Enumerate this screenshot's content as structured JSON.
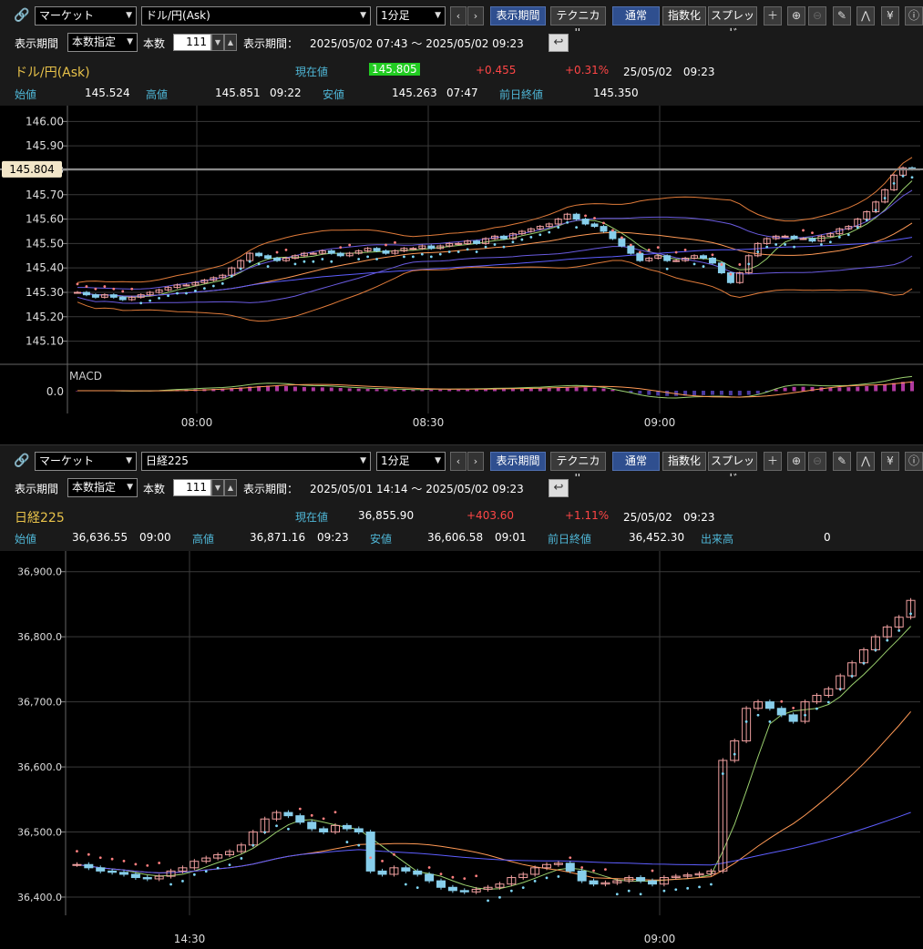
{
  "top": {
    "toolbar": {
      "market": "マーケット",
      "symbol": "ドル/円(Ask)",
      "interval": "1分足",
      "period_btn": "表示期間",
      "technical_btn": "テクニカル",
      "normal_btn": "通常",
      "index_btn": "指数化",
      "spread_btn": "スプレッド"
    },
    "range": {
      "label": "表示期間",
      "mode": "本数指定",
      "count_label": "本数",
      "count": "111",
      "period_label": "表示期間：",
      "period": "2025/05/02 07:43 ～ 2025/05/02 09:23"
    },
    "quote": {
      "name": "ドル/円(Ask)",
      "current_label": "現在値",
      "current": "145.805",
      "change": "+0.455",
      "change_pct": "+0.31%",
      "datetime": "25/05/02　09:23",
      "open_label": "始値",
      "open": "145.524",
      "high_label": "高値",
      "high": "145.851",
      "high_time": "09:22",
      "low_label": "安値",
      "low": "145.263",
      "low_time": "07:47",
      "prev_label": "前日終値",
      "prev": "145.350"
    },
    "chart_data": {
      "type": "candlestick",
      "y_ticks": [
        "146.00",
        "145.90",
        "145.80",
        "145.70",
        "145.60",
        "145.50",
        "145.40",
        "145.30",
        "145.20",
        "145.10"
      ],
      "ylim": [
        145.05,
        146.02
      ],
      "current_marker": "145.804",
      "x_ticks": [
        "08:00",
        "08:30",
        "09:00"
      ],
      "indicator_label": "MACD",
      "indicator_tick": "0.0",
      "closes": [
        145.3,
        145.29,
        145.28,
        145.29,
        145.28,
        145.27,
        145.28,
        145.29,
        145.3,
        145.31,
        145.32,
        145.33,
        145.33,
        145.34,
        145.35,
        145.36,
        145.37,
        145.4,
        145.43,
        145.46,
        145.45,
        145.44,
        145.43,
        145.44,
        145.45,
        145.46,
        145.46,
        145.47,
        145.46,
        145.45,
        145.46,
        145.47,
        145.48,
        145.47,
        145.46,
        145.47,
        145.48,
        145.48,
        145.49,
        145.48,
        145.49,
        145.5,
        145.5,
        145.51,
        145.5,
        145.52,
        145.53,
        145.52,
        145.54,
        145.55,
        145.56,
        145.57,
        145.58,
        145.6,
        145.62,
        145.6,
        145.58,
        145.57,
        145.55,
        145.52,
        145.49,
        145.46,
        145.43,
        145.44,
        145.45,
        145.43,
        145.43,
        145.44,
        145.45,
        145.44,
        145.42,
        145.38,
        145.34,
        145.38,
        145.45,
        145.5,
        145.52,
        145.53,
        145.53,
        145.52,
        145.52,
        145.51,
        145.53,
        145.54,
        145.56,
        145.57,
        145.6,
        145.63,
        145.67,
        145.72,
        145.78,
        145.81,
        145.805
      ]
    }
  },
  "bottom": {
    "toolbar": {
      "market": "マーケット",
      "symbol": "日経225",
      "interval": "1分足",
      "period_btn": "表示期間",
      "technical_btn": "テクニカル",
      "normal_btn": "通常",
      "index_btn": "指数化",
      "spread_btn": "スプレッド"
    },
    "range": {
      "label": "表示期間",
      "mode": "本数指定",
      "count_label": "本数",
      "count": "111",
      "period_label": "表示期間：",
      "period": "2025/05/01 14:14 ～ 2025/05/02 09:23"
    },
    "quote": {
      "name": "日経225",
      "current_label": "現在値",
      "current": "36,855.90",
      "change": "+403.60",
      "change_pct": "+1.11%",
      "datetime": "25/05/02　09:23",
      "open_label": "始値",
      "open": "36,636.55",
      "open_time": "09:00",
      "high_label": "高値",
      "high": "36,871.16",
      "high_time": "09:23",
      "low_label": "安値",
      "low": "36,606.58",
      "low_time": "09:01",
      "prev_label": "前日終値",
      "prev": "36,452.30",
      "volume_label": "出来高",
      "volume": "0"
    },
    "chart_data": {
      "type": "candlestick",
      "y_ticks": [
        "36,900.0",
        "36,800.0",
        "36,700.0",
        "36,600.0",
        "36,500.0",
        "36,400.0"
      ],
      "ylim": [
        36330,
        36915
      ],
      "x_ticks": [
        "14:30",
        "09:00"
      ],
      "closes": [
        36450,
        36445,
        36440,
        36438,
        36435,
        36430,
        36428,
        36432,
        36440,
        36445,
        36455,
        36460,
        36465,
        36470,
        36480,
        36500,
        36520,
        36530,
        36525,
        36515,
        36505,
        36500,
        36510,
        36505,
        36500,
        36440,
        36435,
        36445,
        36440,
        36435,
        36425,
        36415,
        36410,
        36408,
        36412,
        36415,
        36420,
        36430,
        36435,
        36445,
        36450,
        36452,
        36440,
        36425,
        36420,
        36422,
        36425,
        36430,
        36425,
        36420,
        36430,
        36432,
        36434,
        36436,
        36440,
        36610,
        36640,
        36690,
        36700,
        36690,
        36680,
        36670,
        36700,
        36710,
        36720,
        36740,
        36760,
        36780,
        36800,
        36815,
        36830,
        36855.9
      ]
    }
  },
  "colors": {
    "bg": "#000000",
    "toolbar": "#1a1a1a",
    "label_cyan": "#4fb6d6",
    "symbol_yellow": "#e8c24a",
    "up_red": "#ff4646",
    "candle_up": "#f0a0a0",
    "candle_down": "#87ceeb",
    "grid": "#3a3a3a",
    "current_line": "#8f8f8f"
  }
}
